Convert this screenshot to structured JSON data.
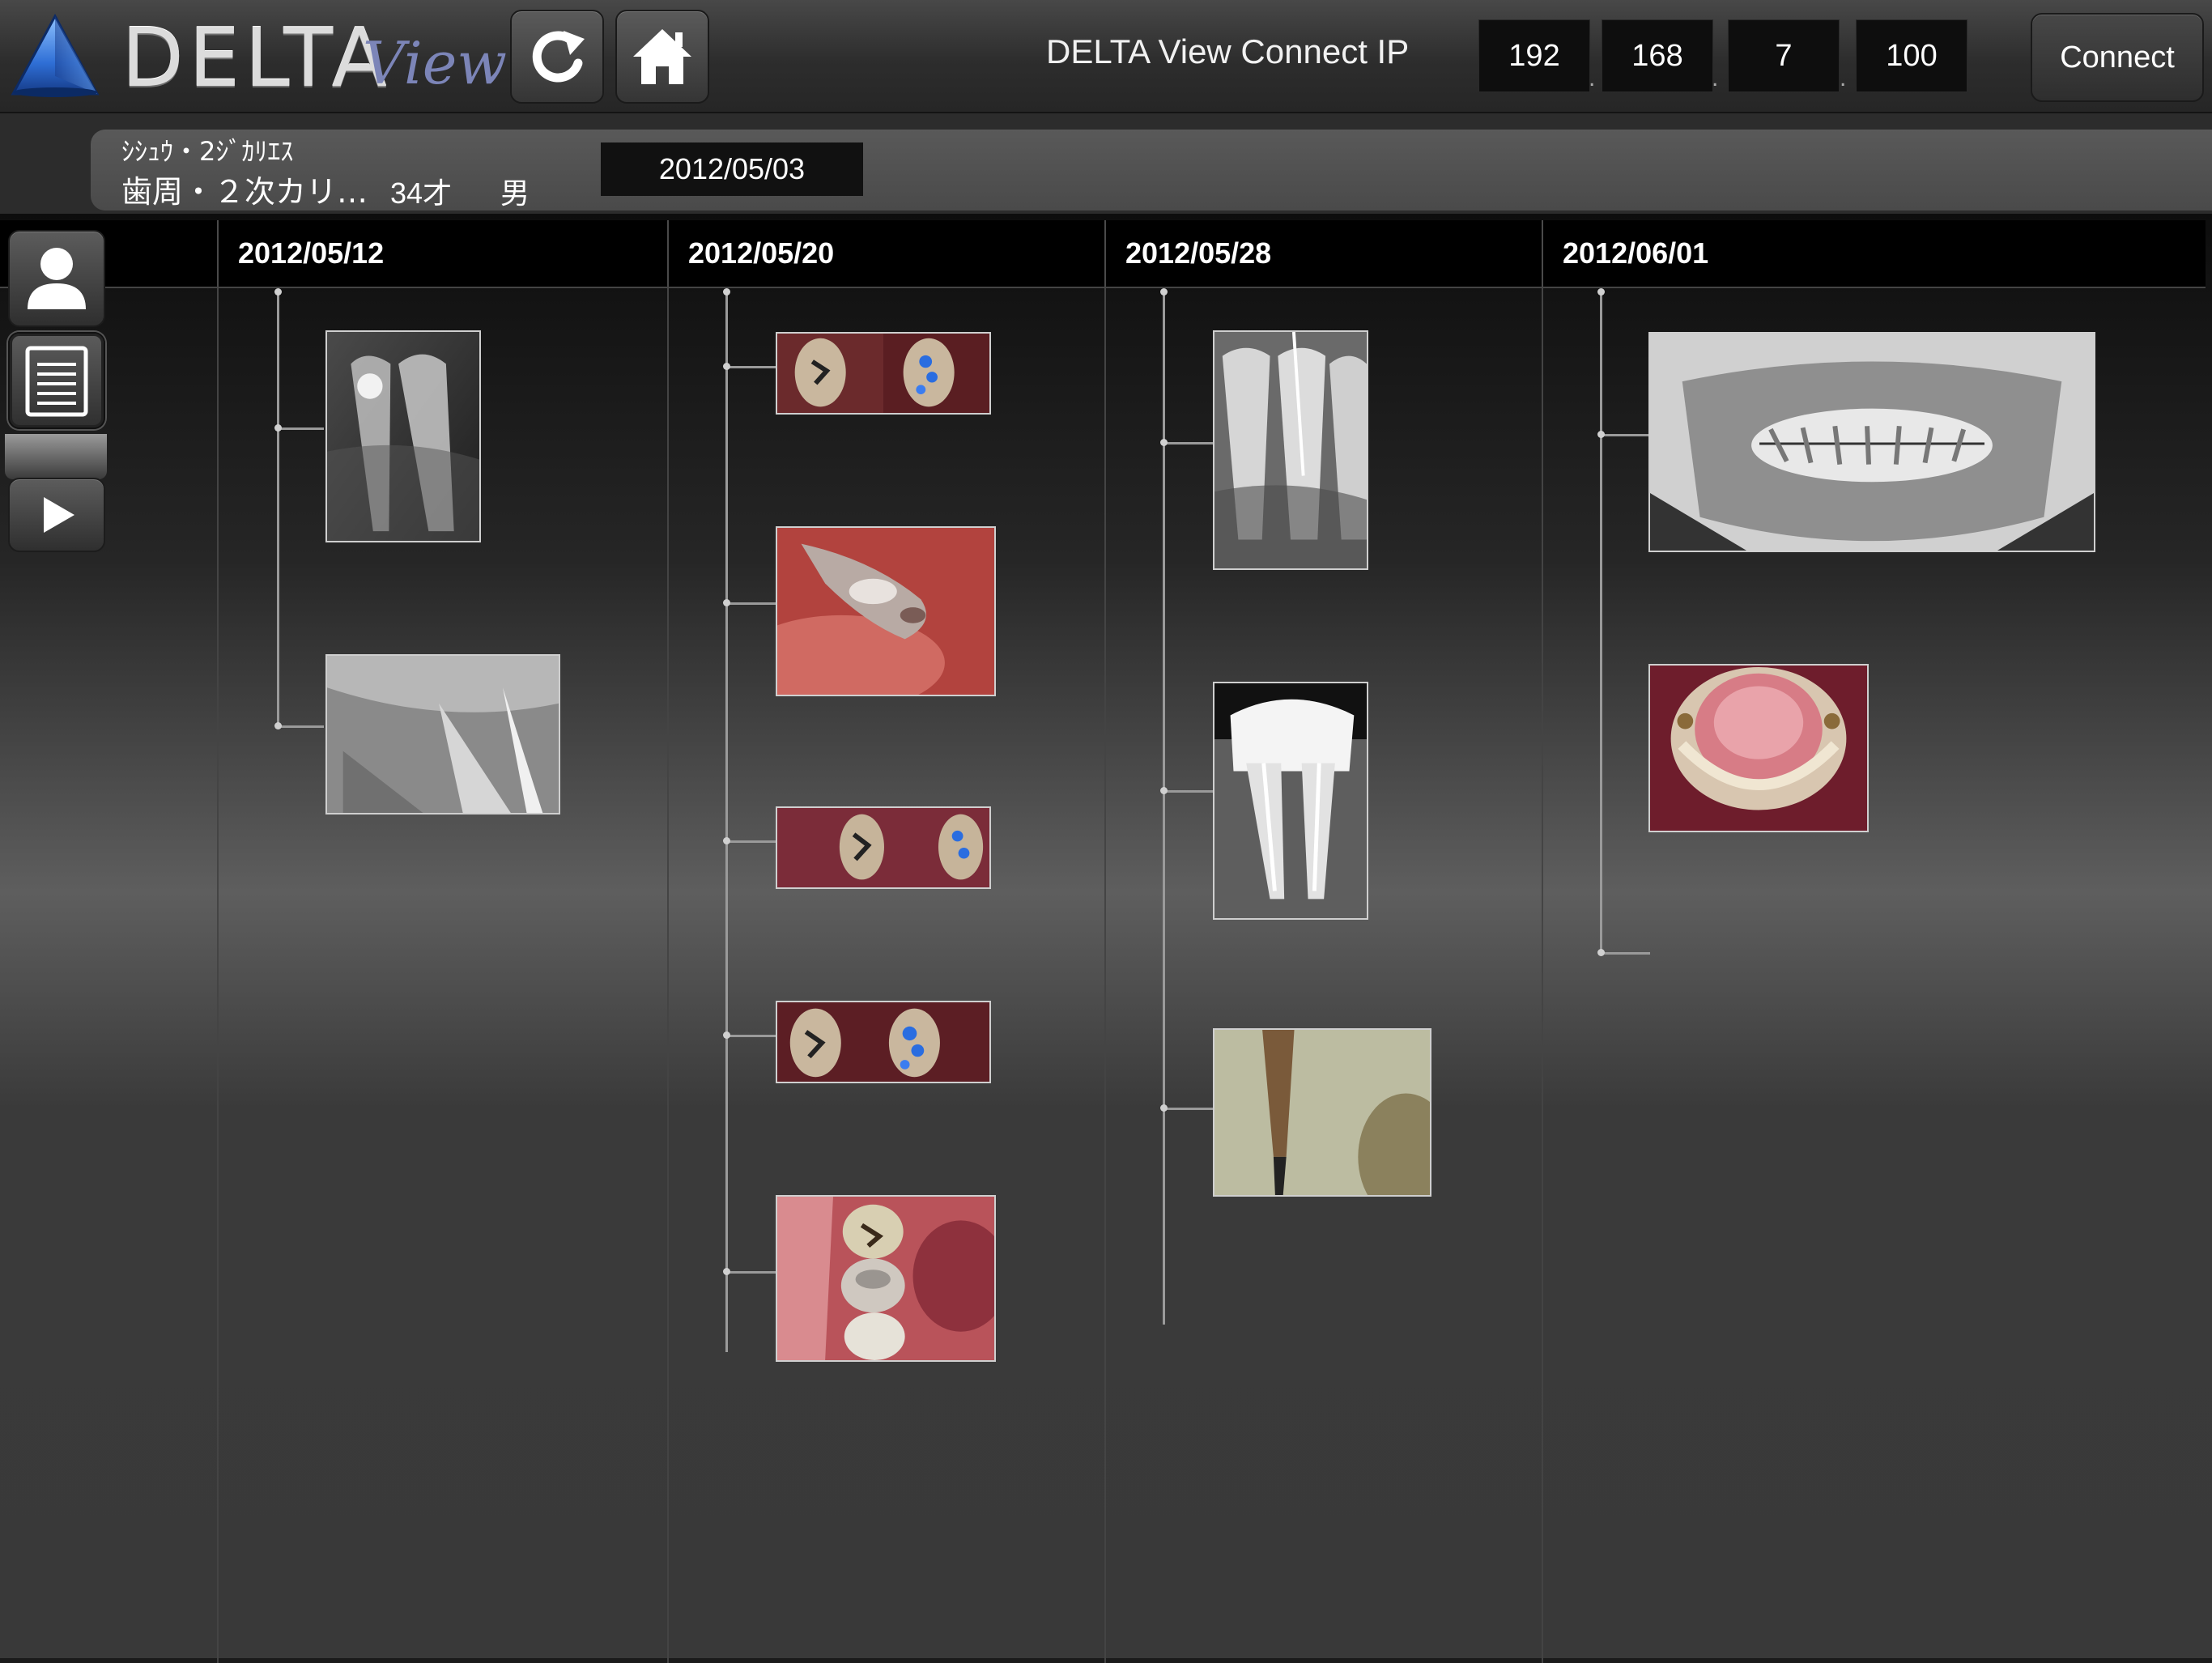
{
  "header": {
    "logo_text": "DELTA",
    "logo_script": "View",
    "connect_label": "DELTA View Connect IP",
    "ip": [
      "192",
      "168",
      "7",
      "100"
    ],
    "ip_separator": ".",
    "connect_button": "Connect",
    "icons": [
      "refresh-icon",
      "home-icon"
    ]
  },
  "patient": {
    "kana": "ｼｼｭｳ・2ｼﾞｶﾘｴｽ",
    "diagnosis": "歯周・２次カリ…",
    "age": "34才",
    "sex": "男",
    "first_visit": "2012/05/03"
  },
  "side": {
    "icons": [
      "patient-icon",
      "document-icon",
      "play-icon"
    ]
  },
  "timeline": {
    "columns": [
      {
        "date": "2012/05/12",
        "images": [
          "x-ray",
          "x-ray"
        ]
      },
      {
        "date": "2012/05/20",
        "images": [
          "intraoral photo",
          "intraoral photo",
          "intraoral photo",
          "intraoral photo",
          "intraoral photo"
        ]
      },
      {
        "date": "2012/05/28",
        "images": [
          "x-ray",
          "x-ray",
          "microscope photo"
        ]
      },
      {
        "date": "2012/06/01",
        "images": [
          "panoramic x-ray",
          "intraoral photo"
        ]
      }
    ]
  },
  "colors": {
    "background": "#1b1b1b",
    "header_cell": "#000000",
    "tree_line": "#9a9a9a",
    "logo_blue": "#2f6fd6"
  }
}
